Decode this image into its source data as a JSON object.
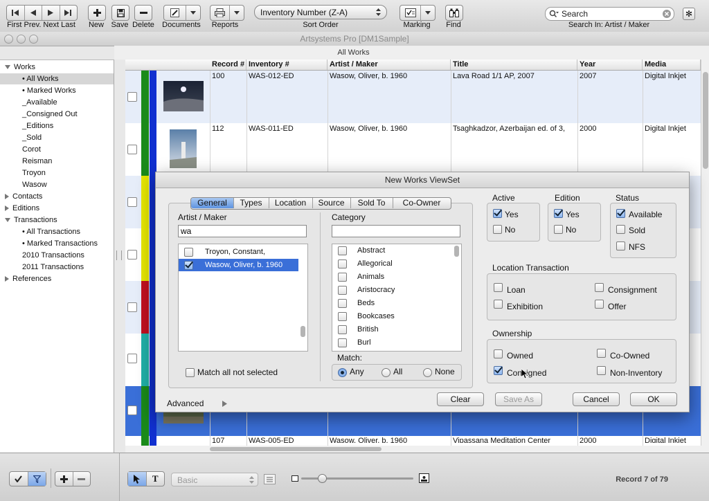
{
  "toolbar": {
    "nav_label": "First Prev. Next Last",
    "new_label": "New",
    "save_label": "Save",
    "delete_label": "Delete",
    "documents_label": "Documents",
    "reports_label": "Reports",
    "sort_value": "Inventory Number (Z-A)",
    "sort_label": "Sort Order",
    "marking_label": "Marking",
    "find_label": "Find",
    "search_placeholder": "Search",
    "search_in": "Search In: Artist / Maker"
  },
  "window": {
    "title": "Artsystems Pro [DM1Sample]",
    "view_title": "All Works"
  },
  "sidebar": {
    "items": [
      {
        "label": "Works"
      },
      {
        "label": "• All Works"
      },
      {
        "label": "• Marked Works"
      },
      {
        "label": "_Available"
      },
      {
        "label": "_Consigned Out"
      },
      {
        "label": "_Editions"
      },
      {
        "label": "_Sold"
      },
      {
        "label": "Corot"
      },
      {
        "label": "Reisman"
      },
      {
        "label": "Troyon"
      },
      {
        "label": "Wasow"
      },
      {
        "label": "Contacts"
      },
      {
        "label": "Editions"
      },
      {
        "label": "Transactions"
      },
      {
        "label": "• All Transactions"
      },
      {
        "label": "• Marked Transactions"
      },
      {
        "label": "2010 Transactions"
      },
      {
        "label": "2011 Transactions"
      },
      {
        "label": "References"
      }
    ]
  },
  "table": {
    "columns": [
      "Record #",
      "Inventory #",
      "Artist / Maker",
      "Title",
      "Year",
      "Media"
    ],
    "rows": [
      {
        "record": "100",
        "inventory": "WAS-012-ED",
        "artist": "Wasow, Oliver, b. 1960",
        "title": "Lava Road 1/1 AP, 2007",
        "year": "2007",
        "media": "Digital Inkjet"
      },
      {
        "record": "112",
        "inventory": "WAS-011-ED",
        "artist": "Wasow, Oliver, b. 1960",
        "title": "Tsaghkadzor, Azerbaijan ed. of 3,",
        "year": "2000",
        "media": "Digital Inkjet"
      },
      {
        "record": "107",
        "inventory": "WAS-005-ED",
        "artist": "Wasow, Oliver, b. 1960",
        "title": "Vipassana Meditation Center",
        "year": "2000",
        "media": "Digital Inkjet"
      }
    ]
  },
  "dialog": {
    "title": "New Works ViewSet",
    "tabs": [
      "General",
      "Types",
      "Location",
      "Source",
      "Sold To",
      "Co-Owner"
    ],
    "artist_label": "Artist / Maker",
    "artist_filter": "wa",
    "artist_items": [
      "Troyon, Constant,",
      "Wasow, Oliver, b. 1960"
    ],
    "match_all_label": "Match all not selected",
    "category_label": "Category",
    "category_items": [
      "Abstract",
      "Allegorical",
      "Animals",
      "Aristocracy",
      "Beds",
      "Bookcases",
      "British",
      "Burl"
    ],
    "match_label": "Match:",
    "match_any": "Any",
    "match_all": "All",
    "match_none": "None",
    "active_label": "Active",
    "edition_label": "Edition",
    "status_label": "Status",
    "yes": "Yes",
    "no": "No",
    "available": "Available",
    "sold": "Sold",
    "nfs": "NFS",
    "location_label": "Location Transaction",
    "loan": "Loan",
    "consignment": "Consignment",
    "exhibition": "Exhibition",
    "offer": "Offer",
    "ownership_label": "Ownership",
    "owned": "Owned",
    "co_owned": "Co-Owned",
    "consigned": "Consigned",
    "non_inventory": "Non-Inventory",
    "advanced": "Advanced",
    "clear": "Clear",
    "save_as": "Save As",
    "cancel": "Cancel",
    "ok": "OK"
  },
  "bottom": {
    "layout_value": "Basic",
    "record_status": "Record 7 of 79"
  },
  "colors": {
    "selection": "#3a6fd8",
    "highlight_row": "#e6edf9",
    "stripe_green": "#1a8a1a",
    "stripe_blue": "#1030d0",
    "stripe_yellow": "#e6e600",
    "stripe_red": "#c01020",
    "stripe_teal": "#20b0a8"
  }
}
